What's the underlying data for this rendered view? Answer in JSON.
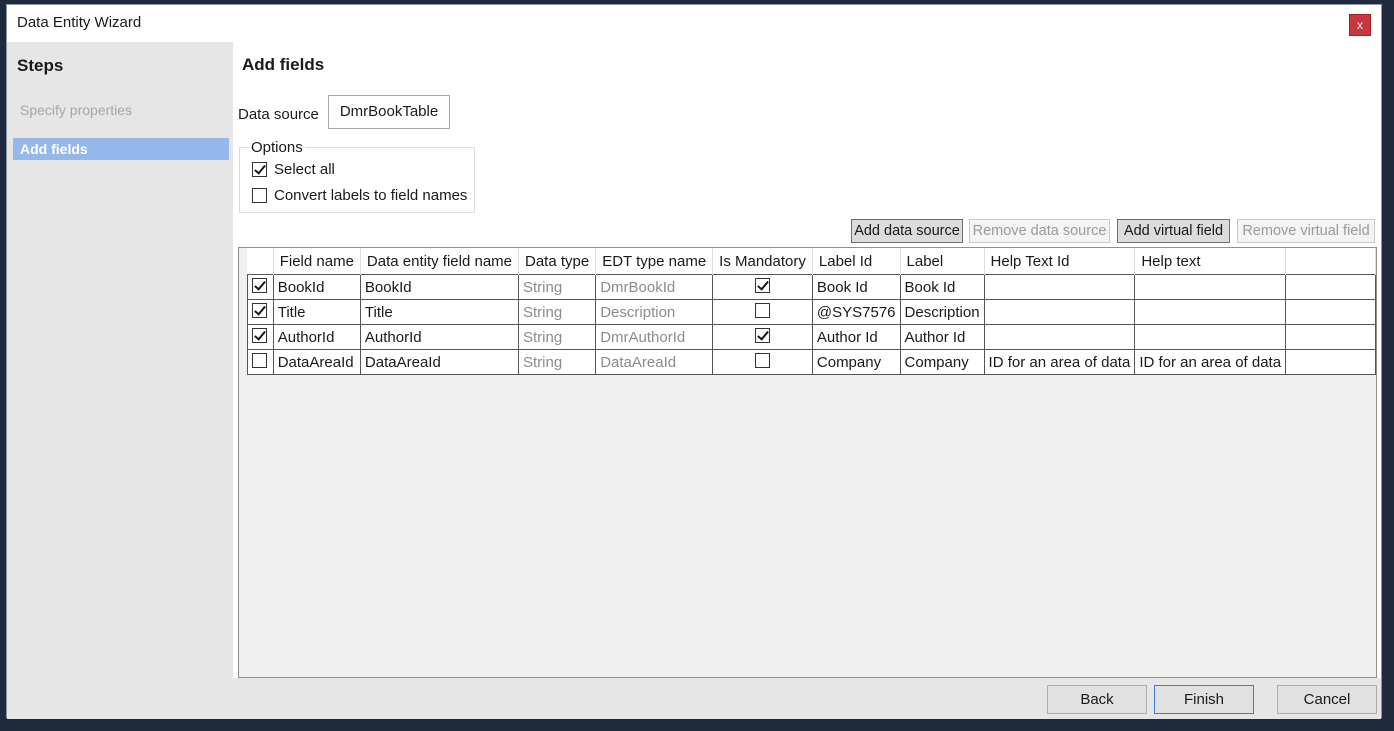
{
  "window": {
    "title": "Data Entity Wizard",
    "close_glyph": "x"
  },
  "steps": {
    "heading": "Steps",
    "items": [
      {
        "label": "Specify properties",
        "state": "inactive"
      },
      {
        "label": "Add fields",
        "state": "active"
      }
    ]
  },
  "main": {
    "heading": "Add fields",
    "data_source_label": "Data source",
    "data_source_value": "DmrBookTable",
    "options": {
      "legend": "Options",
      "select_all": {
        "label": "Select all",
        "checked": true
      },
      "convert_labels": {
        "label": "Convert labels to field names",
        "checked": false
      }
    },
    "toolbar": {
      "add_data_source": "Add data source",
      "remove_data_source": "Remove data source",
      "add_virtual_field": "Add virtual field",
      "remove_virtual_field": "Remove virtual field"
    },
    "grid": {
      "columns": [
        "",
        "Field name",
        "Data entity field name",
        "Data type",
        "EDT type name",
        "Is Mandatory",
        "Label Id",
        "Label",
        "Help Text Id",
        "Help text",
        ""
      ],
      "rows": [
        {
          "selected": true,
          "field_name": "BookId",
          "entity_field_name": "BookId",
          "data_type": "String",
          "edt_type": "DmrBookId",
          "mandatory": true,
          "label_id": "Book Id",
          "label": "Book Id",
          "help_text_id": "",
          "help_text": ""
        },
        {
          "selected": true,
          "field_name": "Title",
          "entity_field_name": "Title",
          "data_type": "String",
          "edt_type": "Description",
          "mandatory": false,
          "label_id": "@SYS7576",
          "label": "Description",
          "help_text_id": "",
          "help_text": ""
        },
        {
          "selected": true,
          "field_name": "AuthorId",
          "entity_field_name": "AuthorId",
          "data_type": "String",
          "edt_type": "DmrAuthorId",
          "mandatory": true,
          "label_id": "Author Id",
          "label": "Author Id",
          "help_text_id": "",
          "help_text": ""
        },
        {
          "selected": false,
          "field_name": "DataAreaId",
          "entity_field_name": "DataAreaId",
          "data_type": "String",
          "edt_type": "DataAreaId",
          "mandatory": false,
          "label_id": "Company",
          "label": "Company",
          "help_text_id": "ID for an area of data",
          "help_text": "ID for an area of data"
        }
      ]
    }
  },
  "footer": {
    "back": "Back",
    "finish": "Finish",
    "cancel": "Cancel"
  }
}
